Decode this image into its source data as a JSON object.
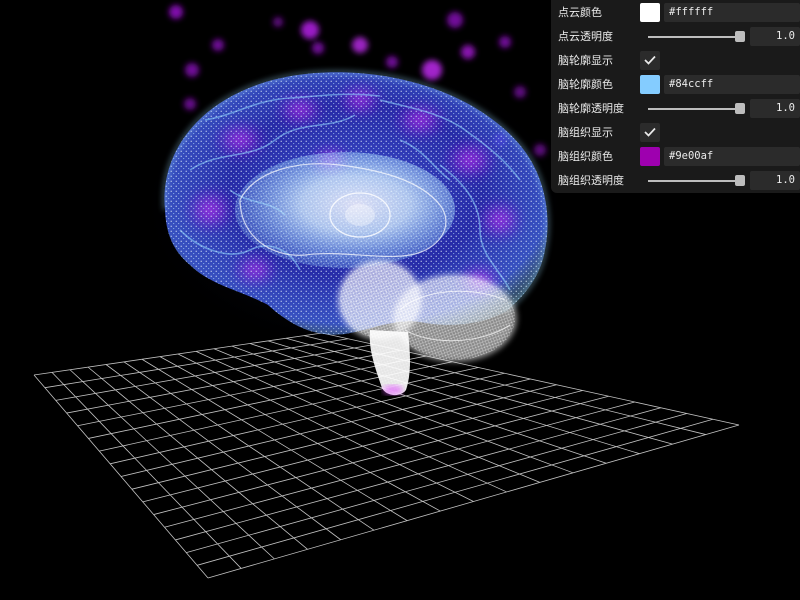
{
  "gui": {
    "point_color": {
      "label": "点云颜色",
      "value": "#ffffff",
      "swatch": "#ffffff"
    },
    "point_opacity": {
      "label": "点云透明度",
      "value": "1.0",
      "level": 1.0
    },
    "outline_show": {
      "label": "脑轮廓显示",
      "checked": true
    },
    "outline_color": {
      "label": "脑轮廓颜色",
      "value": "#84ccff",
      "swatch": "#84ccff"
    },
    "outline_opacity": {
      "label": "脑轮廓透明度",
      "value": "1.0",
      "level": 1.0
    },
    "tissue_show": {
      "label": "脑组织显示",
      "checked": true
    },
    "tissue_color": {
      "label": "脑组织颜色",
      "value": "#9e00af",
      "swatch": "#9e00af"
    },
    "tissue_opacity": {
      "label": "脑组织透明度",
      "value": "1.0",
      "level": 1.0
    }
  },
  "colors": {
    "background": "#000000",
    "panel": "#1a1a1a",
    "field": "#2b2b2b",
    "grid": "#d8d8d8",
    "glow_purple": "#b01ee0",
    "glow_cyan": "#84ccff"
  }
}
